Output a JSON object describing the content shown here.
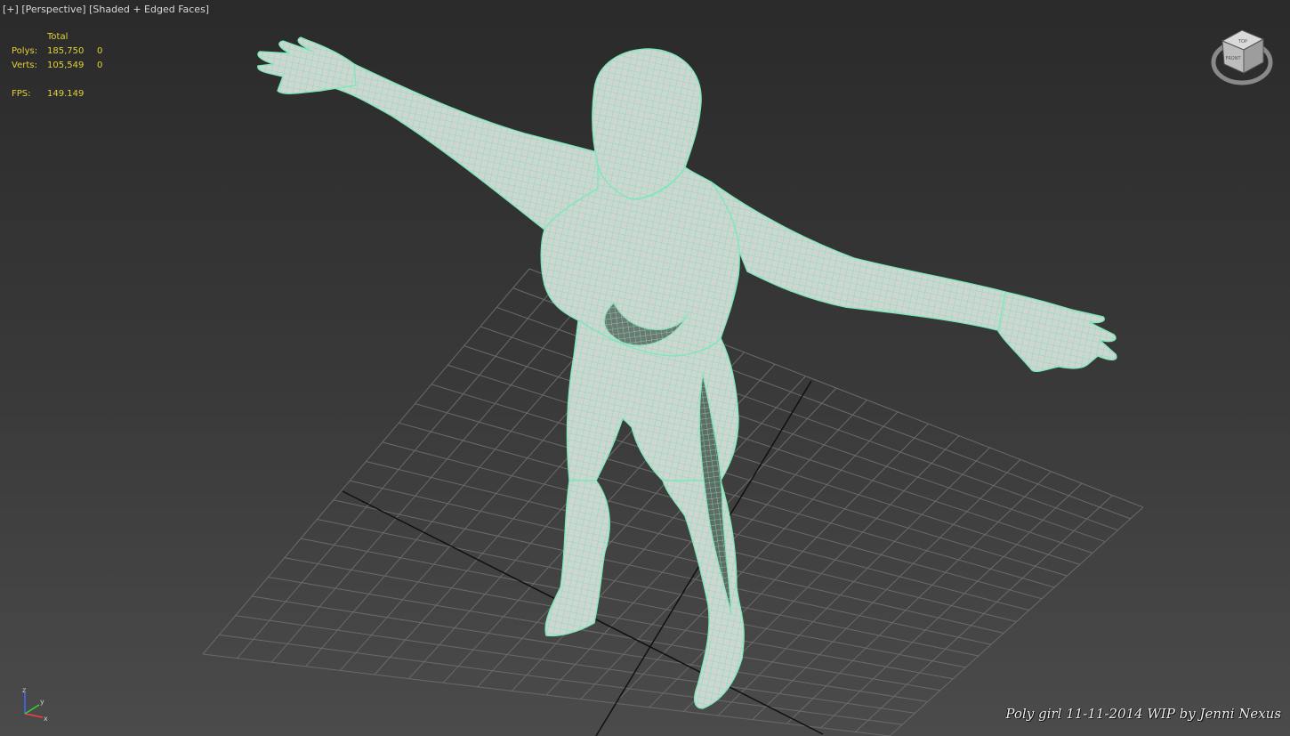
{
  "viewport": {
    "menu_label": "[+]",
    "view_label": "[Perspective]",
    "shading_label": "[Shaded + Edged Faces]"
  },
  "stats": {
    "header": "Total",
    "polys_label": "Polys:",
    "polys_value": "185,750",
    "polys_selected": "0",
    "verts_label": "Verts:",
    "verts_value": "105,549",
    "verts_selected": "0",
    "fps_label": "FPS:",
    "fps_value": "149.149"
  },
  "viewcube": {
    "top_face": "TOP",
    "front_face": "FRONT"
  },
  "axis": {
    "x": "x",
    "y": "y",
    "z": "z"
  },
  "watermark": "Poly girl 11-11-2014 WIP by Jenni Nexus",
  "colors": {
    "background_top": "#2a2a2a",
    "background_bottom": "#4b4b4b",
    "mesh_wire": "#7fe8b8",
    "stats_text": "#e3d23a",
    "label_text": "#d8d8d8",
    "grid_line": "#6a6a6a",
    "grid_axis": "#101010"
  }
}
